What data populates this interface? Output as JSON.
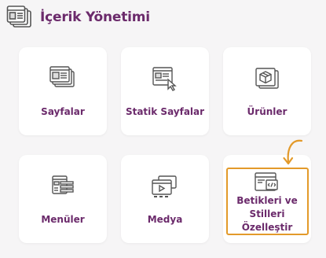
{
  "header": {
    "title": "İçerik Yönetimi",
    "icon": "content-management-icon"
  },
  "cards": {
    "sayfalar": {
      "label": "Sayfalar",
      "icon": "pages-icon"
    },
    "statik": {
      "label": "Statik Sayfalar",
      "icon": "static-page-icon"
    },
    "urunler": {
      "label": "Ürünler",
      "icon": "products-icon"
    },
    "menuler": {
      "label": "Menüler",
      "icon": "menu-icon"
    },
    "medya": {
      "label": "Medya",
      "icon": "media-icon"
    },
    "betik": {
      "label": "Betikleri ve Stilleri Özelleştir",
      "icon": "code-window-icon"
    }
  },
  "colors": {
    "title": "#6b2a6b",
    "card_label": "#6b2a6b",
    "highlight": "#e39a2a",
    "icon_stroke": "#555555",
    "background": "#f6f5f6"
  }
}
